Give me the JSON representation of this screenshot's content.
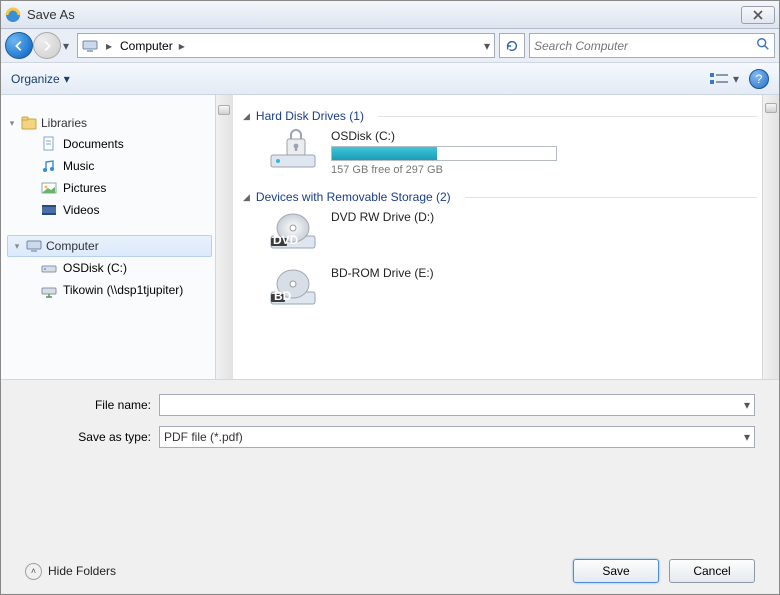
{
  "title": "Save As",
  "nav": {
    "breadcrumb_location": "Computer",
    "search_placeholder": "Search Computer"
  },
  "toolbar": {
    "organize_label": "Organize"
  },
  "sidebar": {
    "libraries_label": "Libraries",
    "libraries": [
      {
        "icon": "documents-icon",
        "label": "Documents"
      },
      {
        "icon": "music-icon",
        "label": "Music"
      },
      {
        "icon": "pictures-icon",
        "label": "Pictures"
      },
      {
        "icon": "videos-icon",
        "label": "Videos"
      }
    ],
    "computer_label": "Computer",
    "computer_items": [
      {
        "icon": "hdd-icon",
        "label": "OSDisk (C:)"
      },
      {
        "icon": "network-drive-icon",
        "label": "Tikowin (\\\\dsp1tjupiter)"
      }
    ]
  },
  "main": {
    "section1_title": "Hard Disk Drives (1)",
    "osdisk": {
      "name": "OSDisk (C:)",
      "free_text": "157 GB free of 297 GB",
      "fill_percent": 47
    },
    "section2_title": "Devices with Removable Storage (2)",
    "removable": [
      {
        "icon": "dvd-icon",
        "label": "DVD RW Drive (D:)"
      },
      {
        "icon": "bd-icon",
        "label": "BD-ROM Drive (E:)"
      }
    ]
  },
  "bottom": {
    "file_name_label": "File name:",
    "file_name_value": "",
    "save_type_label": "Save as type:",
    "save_type_value": "PDF file (*.pdf)",
    "hide_folders_label": "Hide Folders",
    "save_label": "Save",
    "cancel_label": "Cancel"
  },
  "colors": {
    "accent": "#1a3e8c",
    "capacity_fill": "#1fb0c9"
  }
}
